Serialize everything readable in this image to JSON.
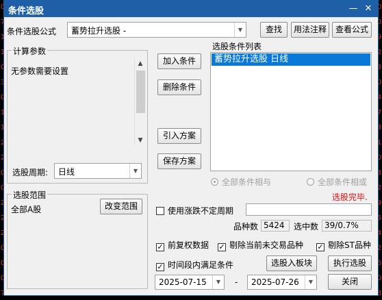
{
  "window": {
    "title": "条件选股",
    "min_glyph": "—",
    "close_glyph": "✕"
  },
  "formula": {
    "label": "条件选股公式",
    "selected": "蓄势拉升选股  -",
    "find_button": "查找",
    "usage_button": "用法注释",
    "view_button": "查看公式"
  },
  "params": {
    "legend": "计算参数",
    "text": "无参数需要设置",
    "period_label": "选股周期:",
    "period_value": "日线"
  },
  "actions": {
    "add": "加入条件",
    "delete": "删除条件",
    "import": "引入方案",
    "save": "保存方案"
  },
  "conditions": {
    "legend": "选股条件列表",
    "items": [
      "蓄势拉升选股  日线"
    ],
    "and_label": "全部条件相与",
    "or_label": "全部条件相或"
  },
  "range": {
    "legend": "选股范围",
    "value": "全部A股",
    "change_button": "改变范围"
  },
  "status": {
    "text": "选股完毕."
  },
  "uncertain_period": {
    "label": "使用涨跌不定周期",
    "value": ""
  },
  "stats": {
    "count_label": "品种数",
    "count_value": "5424",
    "selected_label": "选中数",
    "selected_value": "39/0.7%"
  },
  "options": {
    "fq": "前复权数据",
    "exclude_nontrade": "剔除当前未交易品种",
    "exclude_st": "剔除ST品种",
    "time_range": "时间段内满足条件"
  },
  "buttons": {
    "to_block": "选股入板块",
    "execute": "执行选股",
    "close": "关闭"
  },
  "dates": {
    "start": "2025-07-15",
    "separator": "-",
    "end": "2025-07-26"
  },
  "edge_digits": {
    "left": [
      "0",
      "7",
      "1",
      "1",
      "0",
      "3",
      "0",
      "1",
      "1",
      "2",
      "2",
      "0",
      "0",
      "2",
      "2",
      "2",
      "0",
      "0",
      "0",
      "7"
    ],
    "right": [
      "0",
      "0",
      "9",
      "2",
      "3",
      "0",
      "4",
      "7",
      "3",
      "1",
      "0",
      "3",
      "2",
      "9",
      "5",
      "4",
      "2",
      "6",
      "0",
      "8"
    ]
  },
  "colors": {
    "titlebar": "#1f5fa8",
    "selection": "#0a78d7",
    "status": "#e01010"
  }
}
